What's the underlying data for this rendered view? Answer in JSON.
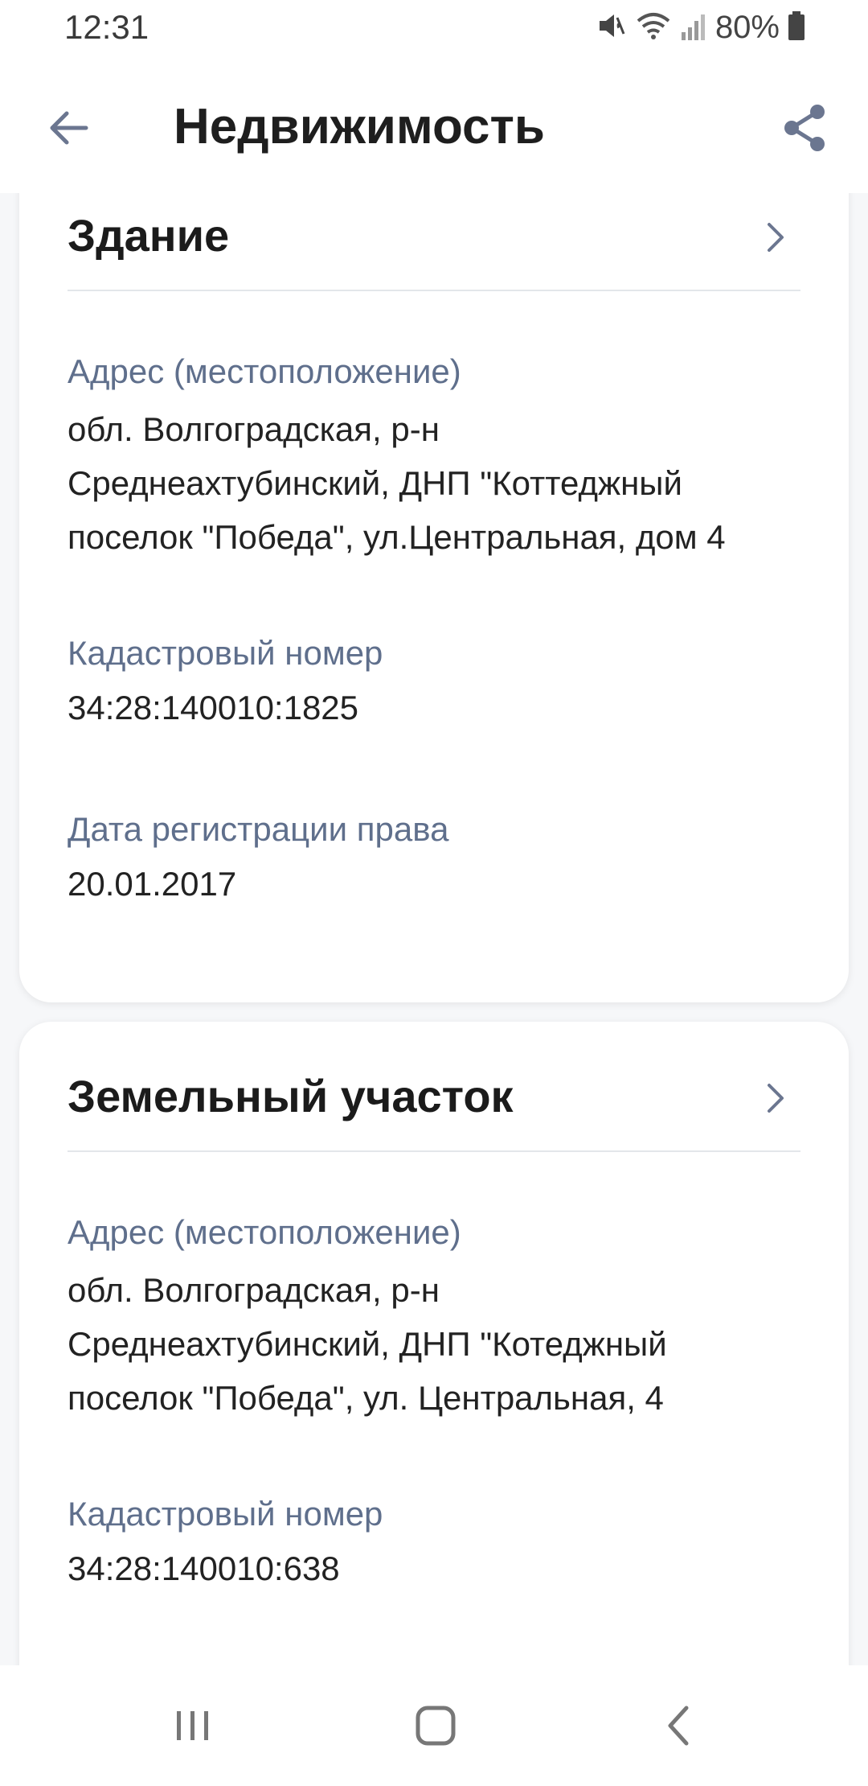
{
  "status_bar": {
    "time": "12:31",
    "battery": "80%",
    "icons": [
      "mute-icon",
      "wifi-icon",
      "signal-icon",
      "battery-icon"
    ]
  },
  "header": {
    "title": "Недвижимость",
    "back_icon": "arrow-left-icon",
    "share_icon": "share-icon"
  },
  "cards": [
    {
      "title": "Здание",
      "fields": [
        {
          "label": "Адрес (местоположение)",
          "value_lines": [
            "обл. Волгоградская, р-н",
            "Среднеахтубинский, ДНП \"Коттеджный",
            "поселок \"Победа\", ул.Центральная, дом 4"
          ]
        },
        {
          "label": "Кадастровый номер",
          "value": "34:28:140010:1825"
        },
        {
          "label": "Дата регистрации права",
          "value": "20.01.2017"
        }
      ]
    },
    {
      "title": "Земельный участок",
      "fields": [
        {
          "label": "Адрес (местоположение)",
          "value_lines": [
            "обл. Волгоградская, р-н",
            "Среднеахтубинский, ДНП \"Котеджный",
            "поселок \"Победа\", ул. Центральная, 4"
          ]
        },
        {
          "label": "Кадастровый номер",
          "value": "34:28:140010:638"
        }
      ]
    }
  ],
  "nav_bar": {
    "icons": [
      "recents-icon",
      "home-icon",
      "back-icon"
    ]
  },
  "colors": {
    "label": "#5f6f8c",
    "icon": "#6b7690",
    "divider": "#e3e6ea"
  }
}
